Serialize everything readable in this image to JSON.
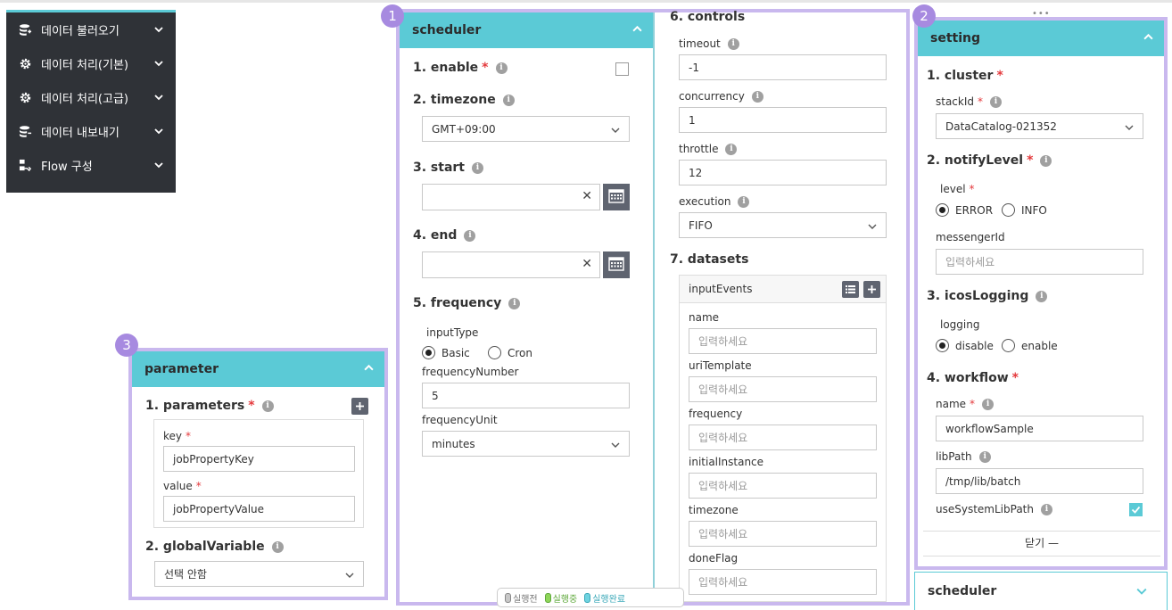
{
  "nav": {
    "items": [
      {
        "label": "데이터 불러오기",
        "icon": "database-import-icon"
      },
      {
        "label": "데이터 처리(기본)",
        "icon": "gear-icon"
      },
      {
        "label": "데이터 처리(고급)",
        "icon": "gear-icon"
      },
      {
        "label": "데이터 내보내기",
        "icon": "database-export-icon"
      },
      {
        "label": "Flow 구성",
        "icon": "flow-icon"
      }
    ]
  },
  "scheduler": {
    "badge": "1",
    "title": "scheduler",
    "enable_label": "1. enable",
    "timezone_label": "2. timezone",
    "timezone_value": "GMT+09:00",
    "start_label": "3. start",
    "end_label": "4. end",
    "frequency_label": "5. frequency",
    "input_type_label": "inputType",
    "basic_label": "Basic",
    "cron_label": "Cron",
    "frequency_number_label": "frequencyNumber",
    "frequency_number_value": "5",
    "frequency_unit_label": "frequencyUnit",
    "frequency_unit_value": "minutes",
    "controls_label": "6. controls",
    "timeout_label": "timeout",
    "timeout_value": "-1",
    "concurrency_label": "concurrency",
    "concurrency_value": "1",
    "throttle_label": "throttle",
    "throttle_value": "12",
    "execution_label": "execution",
    "execution_value": "FIFO",
    "datasets_label": "7. datasets",
    "input_events_label": "inputEvents",
    "fields": [
      {
        "label": "name",
        "placeholder": "입력하세요"
      },
      {
        "label": "uriTemplate",
        "placeholder": "입력하세요"
      },
      {
        "label": "frequency",
        "placeholder": "입력하세요"
      },
      {
        "label": "initialInstance",
        "placeholder": "입력하세요"
      },
      {
        "label": "timezone",
        "placeholder": "입력하세요"
      },
      {
        "label": "doneFlag",
        "placeholder": "입력하세요"
      }
    ]
  },
  "legend": {
    "items": [
      {
        "label": "실행전",
        "color": "#c8c8c8"
      },
      {
        "label": "실행중",
        "color": "#8fd65a"
      },
      {
        "label": "실행완료",
        "color": "#6fd3e0"
      }
    ]
  },
  "setting": {
    "badge": "2",
    "title": "setting",
    "cluster_label": "1. cluster",
    "stack_id_label": "stackId",
    "stack_id_value": "DataCatalog-021352",
    "notify_label": "2. notifyLevel",
    "level_label": "level",
    "error_label": "ERROR",
    "info_label": "INFO",
    "messenger_label": "messengerId",
    "messenger_placeholder": "입력하세요",
    "icos_label": "3. icosLogging",
    "logging_label": "logging",
    "disable_label": "disable",
    "enable_label": "enable",
    "workflow_label": "4. workflow",
    "name_label": "name",
    "name_value": "workflowSample",
    "libpath_label": "libPath",
    "libpath_value": "/tmp/lib/batch",
    "use_system_label": "useSystemLibPath",
    "close_label": "닫기 —"
  },
  "scheduler_collapsed": {
    "title": "scheduler"
  },
  "parameter": {
    "badge": "3",
    "title": "parameter",
    "parameters_label": "1. parameters",
    "key_label": "key",
    "key_value": "jobPropertyKey",
    "value_label": "value",
    "value_value": "jobPropertyValue",
    "global_label": "2. globalVariable",
    "global_value": "선택 안함"
  },
  "colors": {
    "accent": "#5bcad6",
    "panel_border": "#c9b8ee",
    "badge": "#a78ae0",
    "nav_bg": "#2f3237",
    "required": "#e4393c"
  }
}
